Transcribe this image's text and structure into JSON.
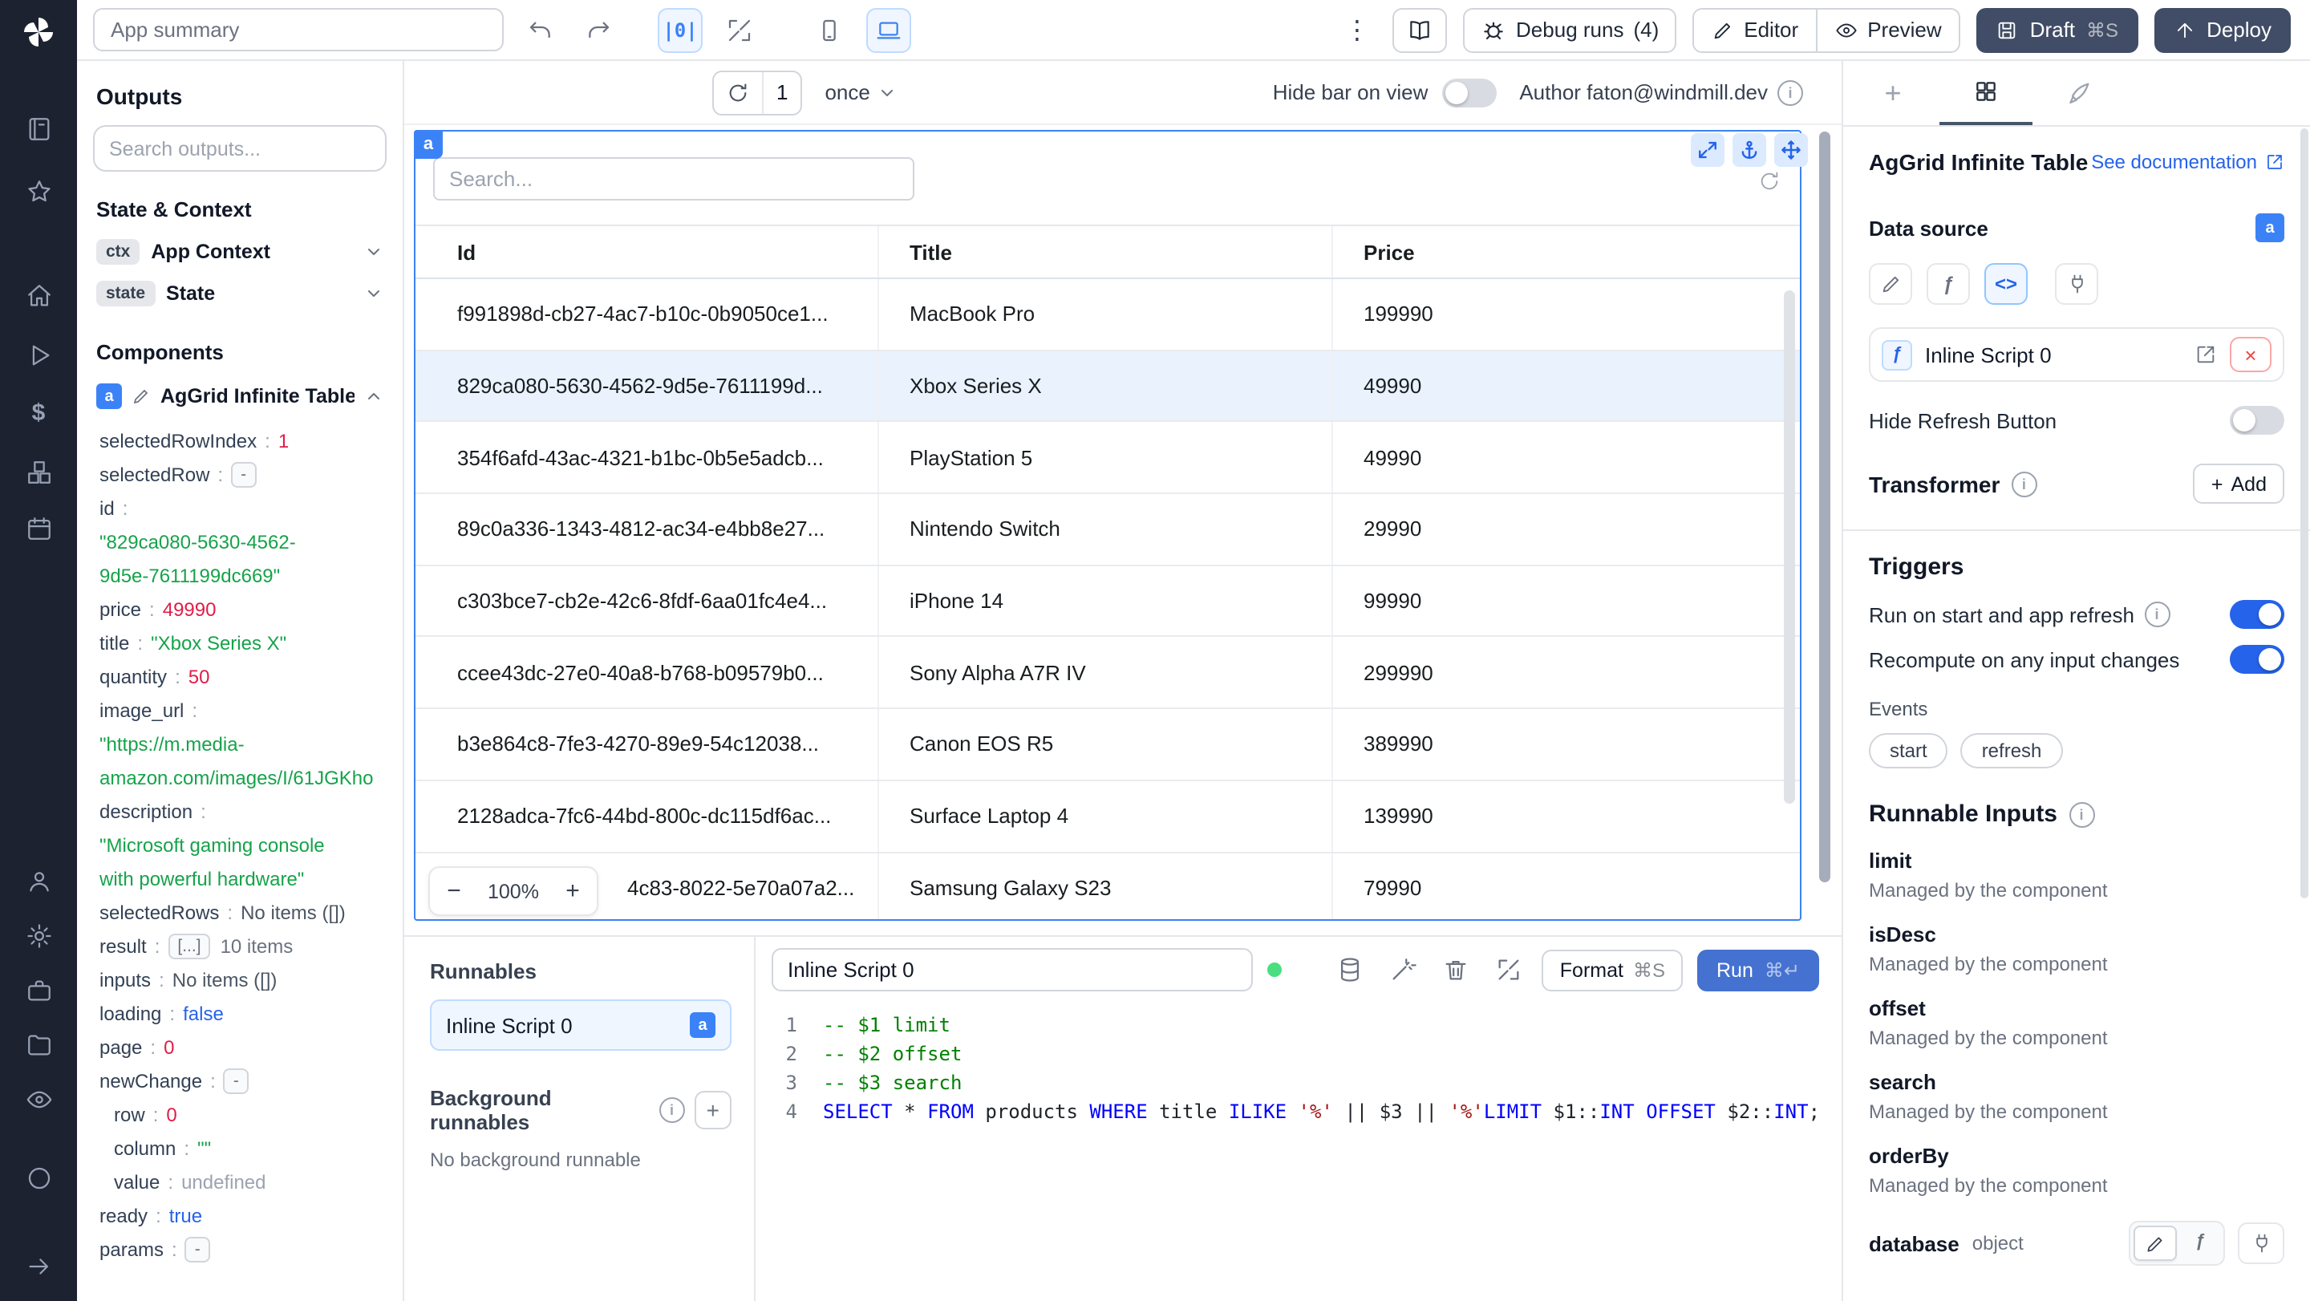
{
  "topbar": {
    "app_summary_placeholder": "App summary",
    "debug_label": "Debug runs",
    "debug_count": "(4)",
    "editor_label": "Editor",
    "preview_label": "Preview",
    "draft_label": "Draft",
    "draft_kbd": "⌘S",
    "deploy_label": "Deploy"
  },
  "canvas_toolbar": {
    "refresh_count": "1",
    "interval_label": "once",
    "hide_bar_label": "Hide bar on view",
    "author_label": "Author faton@windmill.dev"
  },
  "outputs": {
    "title": "Outputs",
    "search_placeholder": "Search outputs...",
    "state_context_title": "State & Context",
    "ctx": {
      "badge": "ctx",
      "label": "App Context"
    },
    "state": {
      "badge": "state",
      "label": "State"
    },
    "components_title": "Components",
    "component": {
      "badge": "a",
      "label": "AgGrid Infinite Table"
    },
    "tree": [
      {
        "k": "selectedRowIndex",
        "colon": ":",
        "v": "1",
        "c": "num"
      },
      {
        "k": "selectedRow",
        "colon": ":",
        "v": "-",
        "c": "box"
      },
      {
        "k": "id",
        "colon": ":",
        "v": "",
        "c": "plain"
      },
      {
        "k": "",
        "colon": "",
        "v": "\"829ca080-5630-4562-",
        "c": "str",
        "rowcls": "cont"
      },
      {
        "k": "",
        "colon": "",
        "v": "9d5e-7611199dc669\"",
        "c": "str",
        "rowcls": "cont"
      },
      {
        "k": "price",
        "colon": ":",
        "v": "49990",
        "c": "num"
      },
      {
        "k": "title",
        "colon": ":",
        "v": "\"Xbox Series X\"",
        "c": "str"
      },
      {
        "k": "quantity",
        "colon": ":",
        "v": "50",
        "c": "num"
      },
      {
        "k": "image_url",
        "colon": ":",
        "v": "",
        "c": "plain"
      },
      {
        "k": "",
        "colon": "",
        "v": "\"https://m.media-",
        "c": "str",
        "rowcls": "cont"
      },
      {
        "k": "",
        "colon": "",
        "v": "amazon.com/images/I/61JGKho",
        "c": "str",
        "rowcls": "cont"
      },
      {
        "k": "description",
        "colon": ":",
        "v": "",
        "c": "plain"
      },
      {
        "k": "",
        "colon": "",
        "v": "\"Microsoft gaming console",
        "c": "str",
        "rowcls": "cont"
      },
      {
        "k": "",
        "colon": "",
        "v": "with powerful hardware\"",
        "c": "str",
        "rowcls": "cont"
      },
      {
        "k": "selectedRows",
        "colon": ":",
        "v": "No items ([])",
        "c": "plain"
      },
      {
        "k": "result",
        "colon": ":",
        "v": "[...]",
        "c": "box",
        "suffix": "10 items"
      },
      {
        "k": "inputs",
        "colon": ":",
        "v": "No items ([])",
        "c": "plain"
      },
      {
        "k": "loading",
        "colon": ":",
        "v": "false",
        "c": "bool"
      },
      {
        "k": "page",
        "colon": ":",
        "v": "0",
        "c": "num"
      },
      {
        "k": "newChange",
        "colon": ":",
        "v": "-",
        "c": "box"
      },
      {
        "k": "row",
        "colon": ":",
        "v": "0",
        "c": "num",
        "rowcls": "ind"
      },
      {
        "k": "column",
        "colon": ":",
        "v": "\"\"",
        "c": "str",
        "rowcls": "ind"
      },
      {
        "k": "value",
        "colon": ":",
        "v": "undefined",
        "c": "undef",
        "rowcls": "ind"
      },
      {
        "k": "ready",
        "colon": ":",
        "v": "true",
        "c": "bool"
      },
      {
        "k": "params",
        "colon": ":",
        "v": "-",
        "c": "box"
      }
    ]
  },
  "table": {
    "badge": "a",
    "search_placeholder": "Search...",
    "columns": [
      "Id",
      "Title",
      "Price"
    ],
    "rows": [
      {
        "id": "f991898d-cb27-4ac7-b10c-0b9050ce1...",
        "title": "MacBook Pro",
        "price": "199990"
      },
      {
        "id": "829ca080-5630-4562-9d5e-7611199d...",
        "title": "Xbox Series X",
        "price": "49990",
        "rowcls": "selected"
      },
      {
        "id": "354f6afd-43ac-4321-b1bc-0b5e5adcb...",
        "title": "PlayStation 5",
        "price": "49990"
      },
      {
        "id": "89c0a336-1343-4812-ac34-e4bb8e27...",
        "title": "Nintendo Switch",
        "price": "29990"
      },
      {
        "id": "c303bce7-cb2e-42c6-8fdf-6aa01fc4e4...",
        "title": "iPhone 14",
        "price": "99990"
      },
      {
        "id": "ccee43dc-27e0-40a8-b768-b09579b0...",
        "title": "Sony Alpha A7R IV",
        "price": "299990"
      },
      {
        "id": "b3e864c8-7fe3-4270-89e9-54c12038...",
        "title": "Canon EOS R5",
        "price": "389990"
      },
      {
        "id": "2128adca-7fc6-44bd-800c-dc115df6ac...",
        "title": "Surface Laptop 4",
        "price": "139990"
      },
      {
        "id": "4c83-8022-5e70a07a2...",
        "title": "Samsung Galaxy S23",
        "price": "79990",
        "idcls": "shifted"
      }
    ],
    "zoom_level": "100%"
  },
  "runnables": {
    "title": "Runnables",
    "item_label": "Inline Script 0",
    "item_badge": "a",
    "background_title": "Background runnables",
    "background_empty": "No background runnable"
  },
  "editor": {
    "name_value": "Inline Script 0",
    "format_label": "Format",
    "format_kbd": "⌘S",
    "run_label": "Run",
    "run_kbd": "⌘↵",
    "lines": [
      {
        "n": "1",
        "tokens": [
          {
            "t": "-- $1 limit",
            "c": "comment"
          }
        ]
      },
      {
        "n": "2",
        "tokens": [
          {
            "t": "-- $2 offset",
            "c": "comment"
          }
        ]
      },
      {
        "n": "3",
        "tokens": [
          {
            "t": "-- $3 search",
            "c": "comment"
          }
        ]
      },
      {
        "n": "4",
        "tokens": [
          {
            "t": "SELECT",
            "c": "kw"
          },
          {
            "t": " * ",
            "c": "op"
          },
          {
            "t": "FROM",
            "c": "kw"
          },
          {
            "t": " products ",
            "c": "id"
          },
          {
            "t": "WHERE",
            "c": "kw"
          },
          {
            "t": " title ",
            "c": "id"
          },
          {
            "t": "ILIKE",
            "c": "kw"
          },
          {
            "t": " ",
            "c": "id"
          },
          {
            "t": "'%'",
            "c": "str"
          },
          {
            "t": " || ",
            "c": "op"
          },
          {
            "t": "$3",
            "c": "id"
          },
          {
            "t": " || ",
            "c": "op"
          },
          {
            "t": "'%'",
            "c": "str"
          },
          {
            "t": "LIMIT",
            "c": "kw"
          },
          {
            "t": " ",
            "c": "id"
          },
          {
            "t": "$1",
            "c": "id"
          },
          {
            "t": "::",
            "c": "op"
          },
          {
            "t": "INT",
            "c": "kw"
          },
          {
            "t": " ",
            "c": "id"
          },
          {
            "t": "OFFSET",
            "c": "kw"
          },
          {
            "t": " ",
            "c": "id"
          },
          {
            "t": "$2",
            "c": "id"
          },
          {
            "t": "::",
            "c": "op"
          },
          {
            "t": "INT",
            "c": "kw"
          },
          {
            "t": ";",
            "c": "op"
          }
        ]
      }
    ]
  },
  "inspector": {
    "title": "AgGrid Infinite Table",
    "doc_link": "See documentation",
    "data_source_label": "Data source",
    "source_badge": "a",
    "script_name": "Inline Script 0",
    "hide_refresh_label": "Hide Refresh Button",
    "transformer_label": "Transformer",
    "add_label": "Add",
    "triggers_title": "Triggers",
    "trigger_rows": [
      {
        "label": "Run on start and app refresh"
      },
      {
        "label": "Recompute on any input changes"
      }
    ],
    "events_label": "Events",
    "chips": [
      "start",
      "refresh"
    ],
    "runnable_inputs_title": "Runnable Inputs",
    "inputs": [
      {
        "name": "limit",
        "desc": "Managed by the component"
      },
      {
        "name": "isDesc",
        "desc": "Managed by the component"
      },
      {
        "name": "offset",
        "desc": "Managed by the component"
      },
      {
        "name": "search",
        "desc": "Managed by the component"
      },
      {
        "name": "orderBy",
        "desc": "Managed by the component"
      }
    ],
    "database_name": "database",
    "database_type": "object"
  }
}
